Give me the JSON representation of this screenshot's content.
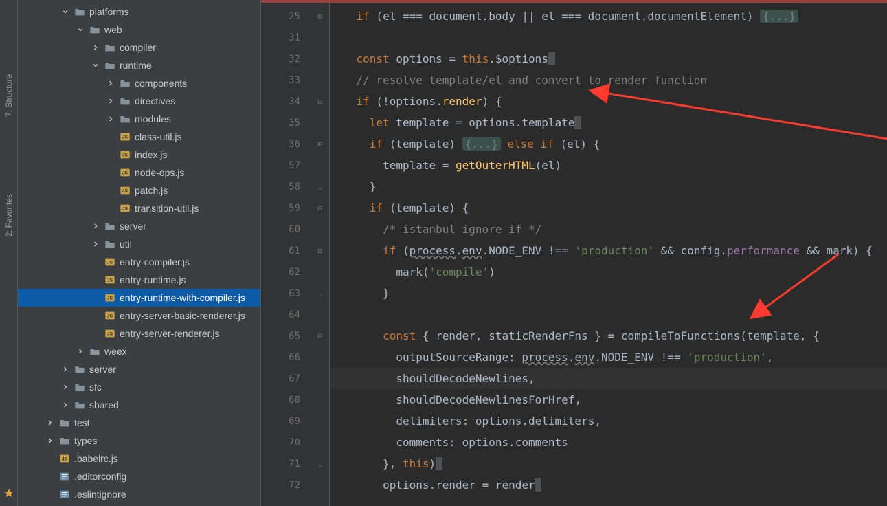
{
  "toolstrip": {
    "structure_label": "7: Structure",
    "favorites_label": "2: Favorites"
  },
  "tree": [
    {
      "depth": 0,
      "type": "folder",
      "expand": "open",
      "name": "platforms"
    },
    {
      "depth": 1,
      "type": "folder",
      "expand": "open",
      "name": "web"
    },
    {
      "depth": 2,
      "type": "folder",
      "expand": "closed",
      "name": "compiler"
    },
    {
      "depth": 2,
      "type": "folder",
      "expand": "open",
      "name": "runtime"
    },
    {
      "depth": 3,
      "type": "folder",
      "expand": "closed",
      "name": "components"
    },
    {
      "depth": 3,
      "type": "folder",
      "expand": "closed",
      "name": "directives"
    },
    {
      "depth": 3,
      "type": "folder",
      "expand": "closed",
      "name": "modules"
    },
    {
      "depth": 3,
      "type": "jsfile",
      "expand": "none",
      "name": "class-util.js"
    },
    {
      "depth": 3,
      "type": "jsfile",
      "expand": "none",
      "name": "index.js"
    },
    {
      "depth": 3,
      "type": "jsfile",
      "expand": "none",
      "name": "node-ops.js"
    },
    {
      "depth": 3,
      "type": "jsfile",
      "expand": "none",
      "name": "patch.js"
    },
    {
      "depth": 3,
      "type": "jsfile",
      "expand": "none",
      "name": "transition-util.js"
    },
    {
      "depth": 2,
      "type": "folder",
      "expand": "closed",
      "name": "server"
    },
    {
      "depth": 2,
      "type": "folder",
      "expand": "closed",
      "name": "util"
    },
    {
      "depth": 2,
      "type": "jsfile",
      "expand": "none",
      "name": "entry-compiler.js"
    },
    {
      "depth": 2,
      "type": "jsfile",
      "expand": "none",
      "name": "entry-runtime.js"
    },
    {
      "depth": 2,
      "type": "jsfile",
      "expand": "none",
      "name": "entry-runtime-with-compiler.js",
      "selected": true
    },
    {
      "depth": 2,
      "type": "jsfile",
      "expand": "none",
      "name": "entry-server-basic-renderer.js"
    },
    {
      "depth": 2,
      "type": "jsfile",
      "expand": "none",
      "name": "entry-server-renderer.js"
    },
    {
      "depth": 1,
      "type": "folder",
      "expand": "closed",
      "name": "weex"
    },
    {
      "depth": 0,
      "type": "folder",
      "expand": "closed",
      "name": "server"
    },
    {
      "depth": 0,
      "type": "folder",
      "expand": "closed",
      "name": "sfc"
    },
    {
      "depth": 0,
      "type": "folder",
      "expand": "closed",
      "name": "shared"
    },
    {
      "depth": -1,
      "type": "folder",
      "expand": "closed",
      "name": "test"
    },
    {
      "depth": -1,
      "type": "folder",
      "expand": "closed",
      "name": "types"
    },
    {
      "depth": -1,
      "type": "jsfile",
      "expand": "none",
      "name": ".babelrc.js"
    },
    {
      "depth": -1,
      "type": "config",
      "expand": "none",
      "name": ".editorconfig"
    },
    {
      "depth": -1,
      "type": "config",
      "expand": "none",
      "name": ".eslintignore"
    }
  ],
  "gutter": {
    "lines": [
      "25",
      "31",
      "32",
      "33",
      "34",
      "35",
      "36",
      "57",
      "58",
      "59",
      "60",
      "61",
      "62",
      "63",
      "64",
      "65",
      "66",
      "67",
      "68",
      "69",
      "70",
      "71",
      "72"
    ],
    "fold": {
      "25": "plus",
      "34": "minus",
      "36": "plus",
      "58": "end",
      "59": "minus",
      "61": "minus",
      "63": "end",
      "65": "minus",
      "71": "end"
    }
  },
  "code": {
    "l25": {
      "t1": "if",
      "t2": " (el === document.body || el === document.documentElement) ",
      "fold": "{...}"
    },
    "l31": "",
    "l32": {
      "kw": "const",
      "t": " options = ",
      "kw2": "this",
      "t2": ".$options"
    },
    "l33": {
      "com": "// resolve template/el and convert to render function"
    },
    "l34": {
      "kw": "if",
      "t": " (!options.",
      "fn": "render",
      "t2": ") {"
    },
    "l35": {
      "kw": "let",
      "t": " template = options.template"
    },
    "l36": {
      "kw": "if",
      "t": " (template) ",
      "fold": "{...}",
      "kw2": " else if",
      "t2": " (el) {"
    },
    "l57": {
      "t": "template = ",
      "fn": "getOuterHTML",
      "t2": "(el)"
    },
    "l58": "}",
    "l59": {
      "kw": "if",
      "t": " (template) {"
    },
    "l60": {
      "com": "/* istanbul ignore if */"
    },
    "l61": {
      "kw": "if",
      "t": " (",
      "u1": "process",
      "t2": ".",
      "u2": "env",
      "t3": ".NODE_ENV !== ",
      "s": "'production'",
      "t4": " && config.",
      "p": "performance",
      "t5": " && mark) {"
    },
    "l62": {
      "t": "mark(",
      "s": "'compile'",
      "t2": ")"
    },
    "l63": "}",
    "l64": "",
    "l65": {
      "kw": "const",
      "t": " { render, staticRenderFns } = compileToFunctions(template, {"
    },
    "l66": {
      "t": "outputSourceRange: ",
      "u1": "process",
      "t2": ".",
      "u2": "env",
      "t3": ".NODE_ENV !== ",
      "s": "'production'",
      "t4": ","
    },
    "l67": {
      "t": "shouldDecodeNewlines,"
    },
    "l68": {
      "t": "shouldDecodeNewlinesForHref,"
    },
    "l69": {
      "t": "delimiters: options.delimiters,"
    },
    "l70": {
      "t": "comments: options.comments"
    },
    "l71": {
      "t": "}, ",
      "kw": "this",
      "t2": ")"
    },
    "l72": {
      "t": "options.render = render"
    }
  }
}
